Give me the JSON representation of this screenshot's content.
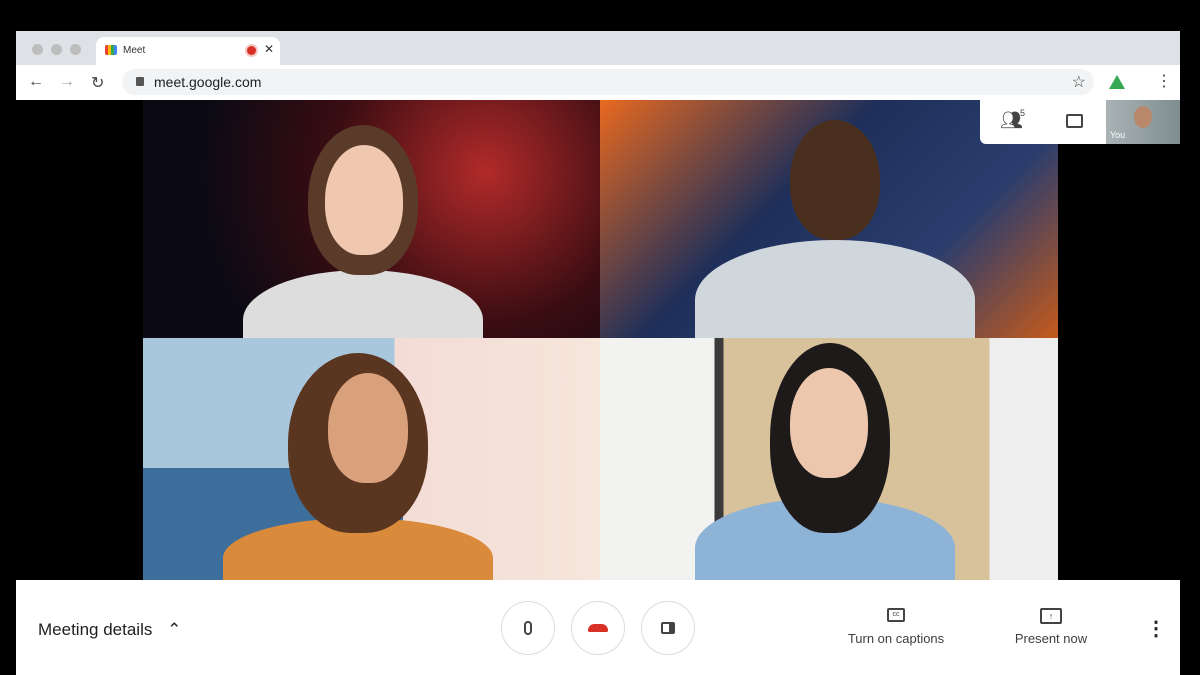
{
  "browser": {
    "tab_title": "Meet",
    "url": "meet.google.com"
  },
  "panel": {
    "participants_count": "5",
    "self_label": "You"
  },
  "bottom": {
    "meeting_details": "Meeting details",
    "captions": "Turn on captions",
    "present": "Present now"
  },
  "colors": {
    "hangup": "#d93025",
    "recording": "#d93025"
  }
}
